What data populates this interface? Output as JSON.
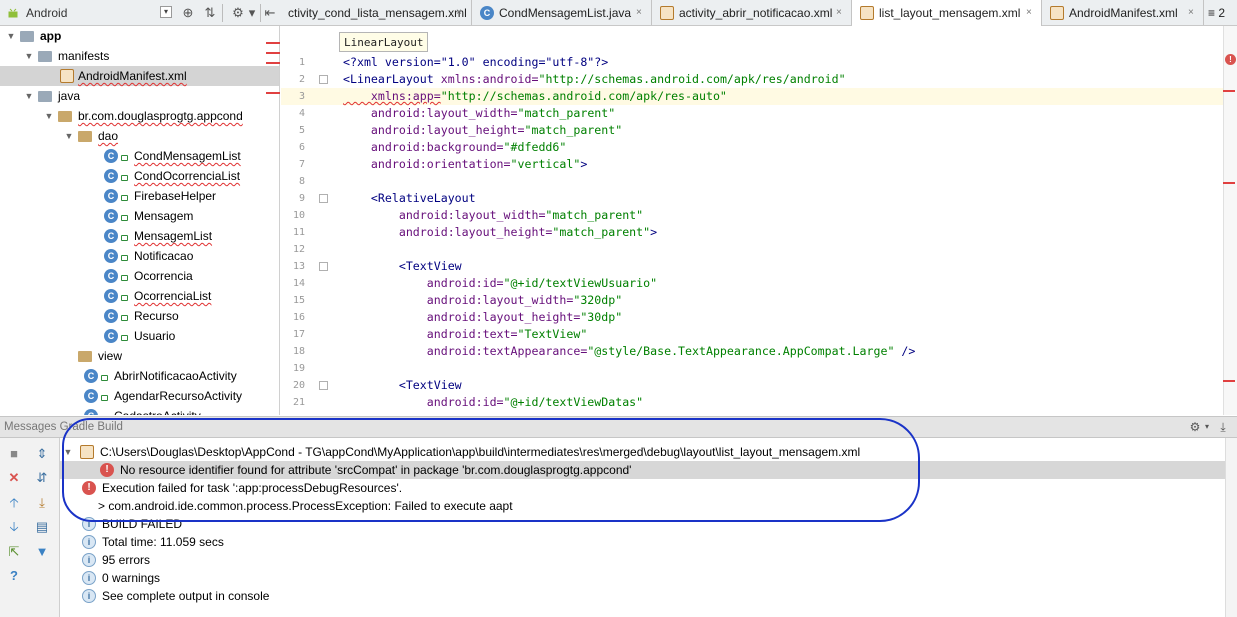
{
  "project_view": {
    "label": "Android"
  },
  "editor_tabs": [
    {
      "label": "ctivity_cond_lista_mensagem.xml",
      "kind": "xml"
    },
    {
      "label": "CondMensagemList.java",
      "kind": "class"
    },
    {
      "label": "activity_abrir_notificacao.xml",
      "kind": "xml"
    },
    {
      "label": "list_layout_mensagem.xml",
      "kind": "xml",
      "active": true
    },
    {
      "label": "AndroidManifest.xml",
      "kind": "xml"
    },
    {
      "label": "≡ 2"
    }
  ],
  "tree": [
    {
      "label": "app",
      "bold": true,
      "type": "module"
    },
    {
      "label": "manifests",
      "type": "folder"
    },
    {
      "label": "AndroidManifest.xml",
      "type": "xml",
      "selected": true,
      "error": true
    },
    {
      "label": "java",
      "type": "folder"
    },
    {
      "label": "br.com.douglasprogtg.appcond",
      "type": "package",
      "error": true
    },
    {
      "label": "dao",
      "type": "package",
      "error": true
    },
    {
      "label": "CondMensagemList",
      "type": "class",
      "error": true
    },
    {
      "label": "CondOcorrenciaList",
      "type": "class",
      "error": true
    },
    {
      "label": "FirebaseHelper",
      "type": "class"
    },
    {
      "label": "Mensagem",
      "type": "class"
    },
    {
      "label": "MensagemList",
      "type": "class",
      "error": true
    },
    {
      "label": "Notificacao",
      "type": "class"
    },
    {
      "label": "Ocorrencia",
      "type": "class"
    },
    {
      "label": "OcorrenciaList",
      "type": "class",
      "error": true
    },
    {
      "label": "Recurso",
      "type": "class"
    },
    {
      "label": "Usuario",
      "type": "class"
    },
    {
      "label": "view",
      "type": "package"
    },
    {
      "label": "AbrirNotificacaoActivity",
      "type": "class"
    },
    {
      "label": "AgendarRecursoActivity",
      "type": "class"
    },
    {
      "label": "CadastroActivity",
      "type": "class"
    }
  ],
  "editor": {
    "breadcrumb": "LinearLayout",
    "current_line": 3,
    "line_numbers": [
      "1",
      "2",
      "3",
      "4",
      "5",
      "6",
      "7",
      "8",
      "9",
      "10",
      "11",
      "12",
      "13",
      "14",
      "15",
      "16",
      "17",
      "18",
      "19",
      "20",
      "21"
    ],
    "lines": [
      [
        {
          "t": "pi",
          "s": "<?xml version=\"1.0\" encoding=\"utf-8\"?>"
        }
      ],
      [
        {
          "t": "tag",
          "s": "<LinearLayout "
        },
        {
          "t": "attr",
          "s": "xmlns:android="
        },
        {
          "t": "val",
          "s": "\"http://schemas.android.com/apk/res/android\""
        }
      ],
      [
        {
          "t": "attr",
          "s": "    xmlns:app="
        },
        {
          "t": "val",
          "s": "\"http://schemas.android.com/apk/res-auto\""
        }
      ],
      [
        {
          "t": "attr",
          "s": "    android:layout_width="
        },
        {
          "t": "val",
          "s": "\"match_parent\""
        }
      ],
      [
        {
          "t": "attr",
          "s": "    android:layout_height="
        },
        {
          "t": "val",
          "s": "\"match_parent\""
        }
      ],
      [
        {
          "t": "attr",
          "s": "    android:background="
        },
        {
          "t": "val",
          "s": "\"#dfedd6\""
        }
      ],
      [
        {
          "t": "attr",
          "s": "    android:orientation="
        },
        {
          "t": "val",
          "s": "\"vertical\""
        },
        {
          "t": "tag",
          "s": ">"
        }
      ],
      [],
      [
        {
          "t": "tag",
          "s": "    <RelativeLayout"
        }
      ],
      [
        {
          "t": "attr",
          "s": "        android:layout_width="
        },
        {
          "t": "val",
          "s": "\"match_parent\""
        }
      ],
      [
        {
          "t": "attr",
          "s": "        android:layout_height="
        },
        {
          "t": "val",
          "s": "\"match_parent\""
        },
        {
          "t": "tag",
          "s": ">"
        }
      ],
      [],
      [
        {
          "t": "tag",
          "s": "        <TextView"
        }
      ],
      [
        {
          "t": "attr",
          "s": "            android:id="
        },
        {
          "t": "val",
          "s": "\"@+id/textViewUsuario\""
        }
      ],
      [
        {
          "t": "attr",
          "s": "            android:layout_width="
        },
        {
          "t": "val",
          "s": "\"320dp\""
        }
      ],
      [
        {
          "t": "attr",
          "s": "            android:layout_height="
        },
        {
          "t": "val",
          "s": "\"30dp\""
        }
      ],
      [
        {
          "t": "attr",
          "s": "            android:text="
        },
        {
          "t": "val",
          "s": "\"TextView\""
        }
      ],
      [
        {
          "t": "attr",
          "s": "            android:textAppearance="
        },
        {
          "t": "val",
          "s": "\"@style/Base.TextAppearance.AppCompat.Large\""
        },
        {
          "t": "tag",
          "s": " />"
        }
      ],
      [],
      [
        {
          "t": "tag",
          "s": "        <TextView"
        }
      ],
      [
        {
          "t": "attr",
          "s": "            android:id="
        },
        {
          "t": "val",
          "s": "\"@+id/textViewDatas\""
        }
      ]
    ]
  },
  "messages_panel": {
    "title": "Messages Gradle Build",
    "rows": [
      {
        "icon": "file",
        "arrow": "▼",
        "text": "C:\\Users\\Douglas\\Desktop\\AppCond - TG\\appCond\\MyApplication\\app\\build\\intermediates\\res\\merged\\debug\\layout\\list_layout_mensagem.xml",
        "indent": 0
      },
      {
        "icon": "err",
        "text": "No resource identifier found for attribute 'srcCompat' in package 'br.com.douglasprogtg.appcond'",
        "indent": 1,
        "selected": true
      },
      {
        "icon": "err",
        "text": "Execution failed for task ':app:processDebugResources'.",
        "indent": 0
      },
      {
        "icon": "",
        "text": "> com.android.ide.common.process.ProcessException: Failed to execute aapt",
        "indent": 0
      },
      {
        "icon": "info",
        "text": "BUILD FAILED",
        "indent": 0
      },
      {
        "icon": "info",
        "text": "Total time: 11.059 secs",
        "indent": 0
      },
      {
        "icon": "info",
        "text": "95 errors",
        "indent": 0
      },
      {
        "icon": "info",
        "text": "0 warnings",
        "indent": 0
      },
      {
        "icon": "info",
        "text": "See complete output in console",
        "indent": 0
      }
    ]
  },
  "colors": {
    "error": "#d9534f",
    "selection": "#d7d7d7",
    "annotation_ring": "#1a33c7"
  }
}
